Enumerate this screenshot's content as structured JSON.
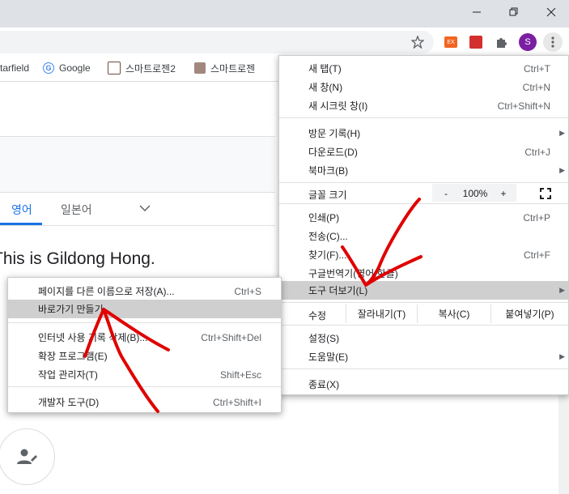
{
  "window": {
    "minimize_label": "—",
    "restore_label": "❐",
    "close_label": "✕"
  },
  "toolbar": {
    "profile_initial": "S",
    "ext1_label": "EX"
  },
  "bookmarks": [
    {
      "label": "tarfield",
      "icon": "starfield-icon",
      "color": "#7b1fa2"
    },
    {
      "label": "Google",
      "icon": "google-icon",
      "color": "#4285f4"
    },
    {
      "label": "스마트로젠2",
      "icon": "image-icon",
      "color": "#6d4c41"
    },
    {
      "label": "스마트로젠",
      "icon": "package-icon",
      "color": "#8d6e63"
    }
  ],
  "page": {
    "lang_tabs": [
      "영어",
      "일본어"
    ],
    "result_text": "This is Gildong Hong."
  },
  "menu": {
    "items": [
      {
        "label": "새 탭(T)",
        "shortcut": "Ctrl+T"
      },
      {
        "label": "새 창(N)",
        "shortcut": "Ctrl+N"
      },
      {
        "label": "새 시크릿 창(I)",
        "shortcut": "Ctrl+Shift+N"
      },
      {
        "label": "방문 기록(H)",
        "shortcut": ""
      },
      {
        "label": "다운로드(D)",
        "shortcut": "Ctrl+J"
      },
      {
        "label": "북마크(B)",
        "shortcut": ""
      },
      {
        "label": "인쇄(P)",
        "shortcut": "Ctrl+P"
      },
      {
        "label": "전송(C)...",
        "shortcut": ""
      },
      {
        "label": "찾기(F)...",
        "shortcut": "Ctrl+F"
      },
      {
        "label": "구글번역기(영어,한글)",
        "shortcut": ""
      },
      {
        "label": "도구 더보기(L)",
        "shortcut": ""
      },
      {
        "label": "설정(S)",
        "shortcut": ""
      },
      {
        "label": "도움말(E)",
        "shortcut": ""
      },
      {
        "label": "종료(X)",
        "shortcut": ""
      }
    ],
    "zoom": {
      "label": "글꼴 크기",
      "minus": "-",
      "value": "100%",
      "plus": "+"
    },
    "edit": {
      "label": "수정",
      "cut": "잘라내기(T)",
      "copy": "복사(C)",
      "paste": "붙여넣기(P)"
    }
  },
  "submenu": {
    "items": [
      {
        "label": "페이지를 다른 이름으로 저장(A)...",
        "shortcut": "Ctrl+S"
      },
      {
        "label": "바로가기 만들기...",
        "shortcut": ""
      },
      {
        "label": "인터넷 사용 기록 삭제(B)...",
        "shortcut": "Ctrl+Shift+Del"
      },
      {
        "label": "확장 프로그램(E)",
        "shortcut": ""
      },
      {
        "label": "작업 관리자(T)",
        "shortcut": "Shift+Esc"
      },
      {
        "label": "개발자 도구(D)",
        "shortcut": "Ctrl+Shift+I"
      }
    ]
  },
  "colors": {
    "accent": "#1a73e8",
    "highlight": "#cfcfcf",
    "annotation": "#e00000"
  }
}
